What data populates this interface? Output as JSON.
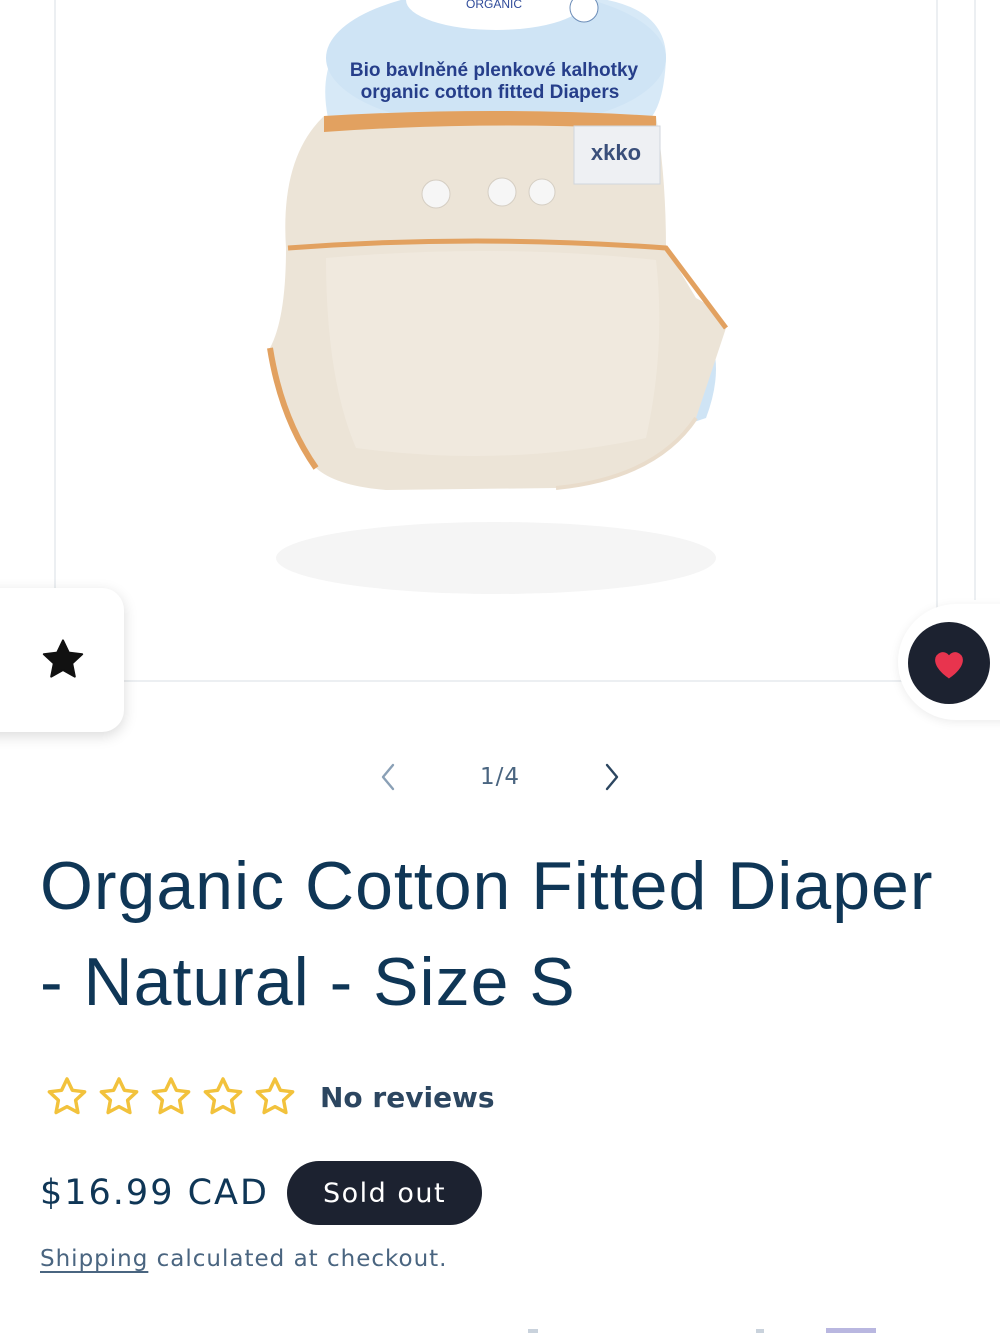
{
  "product": {
    "image": {
      "alt": "organic cotton fitted diaper",
      "brand_logo_text": "xkko",
      "label_badge": "ORGANIC",
      "package_text_line1": "Bio bavlněné plenkové kalhotky",
      "package_text_line2": "organic cotton fitted Diapers",
      "diaper_tag_text": "xkko"
    },
    "slider": {
      "counter": "1/4",
      "prev_icon": "chevron-left-icon",
      "next_icon": "chevron-right-icon"
    },
    "title": "Organic Cotton Fitted Diaper - Natural - Size S",
    "rating": {
      "stars_filled": 0,
      "stars_total": 5,
      "text": "No reviews",
      "star_color": "#f2c23c"
    },
    "price": "$16.99 CAD",
    "badge": "Sold out",
    "shipping_link": "Shipping",
    "shipping_rest": " calculated at checkout."
  },
  "floating": {
    "reviews_icon": "star-icon",
    "wishlist_icon": "heart-icon",
    "wishlist_color": "#e8344e"
  },
  "colors": {
    "text_primary": "#0f3656",
    "badge_bg": "#1c2230"
  }
}
